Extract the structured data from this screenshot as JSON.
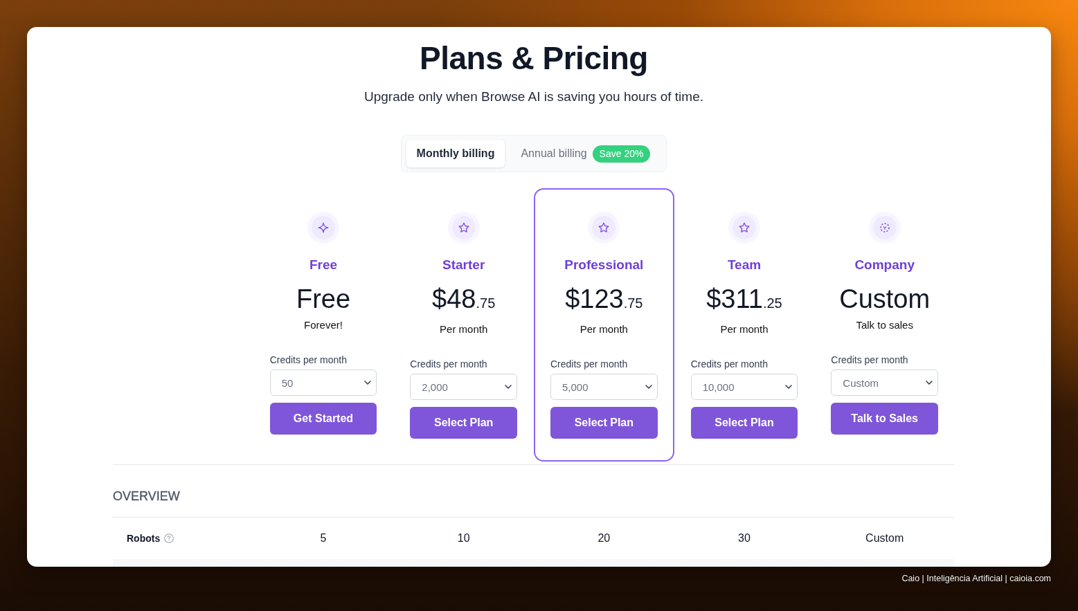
{
  "header": {
    "title": "Plans & Pricing",
    "subtitle": "Upgrade only when Browse AI is saving you hours of time."
  },
  "billing_toggle": {
    "tabs": [
      {
        "label": "Monthly billing",
        "selected": true
      },
      {
        "label": "Annual billing",
        "selected": false,
        "badge": "Save 20%"
      }
    ]
  },
  "plans": [
    {
      "kind": "free",
      "name": "Free",
      "price": "Free",
      "note": "Forever!",
      "credits_label": "Credits per month",
      "credits_value": "50",
      "button": "Get Started",
      "highlighted": false
    },
    {
      "kind": "paid",
      "name": "Starter",
      "price": "$48",
      "cents": ".75",
      "note": "Per month",
      "credits_label": "Credits per month",
      "credits_value": "2,000",
      "button": "Select Plan",
      "highlighted": false
    },
    {
      "kind": "paid",
      "name": "Professional",
      "price": "$123",
      "cents": ".75",
      "note": "Per month",
      "credits_label": "Credits per month",
      "credits_value": "5,000",
      "button": "Select Plan",
      "highlighted": true
    },
    {
      "kind": "paid",
      "name": "Team",
      "price": "$311",
      "cents": ".25",
      "note": "Per month",
      "credits_label": "Credits per month",
      "credits_value": "10,000",
      "button": "Select Plan",
      "highlighted": false
    },
    {
      "kind": "custom",
      "name": "Company",
      "price": "Custom",
      "note": "Talk to sales",
      "credits_label": "Credits per month",
      "credits_value": "Custom",
      "button": "Talk to Sales",
      "highlighted": false
    }
  ],
  "overview": {
    "title": "OVERVIEW",
    "rows": [
      {
        "label": "Robots",
        "help": true,
        "values": [
          "5",
          "10",
          "20",
          "30",
          "Custom"
        ]
      }
    ]
  },
  "credit": "Caio | Inteligência Artificial | caioia.com"
}
